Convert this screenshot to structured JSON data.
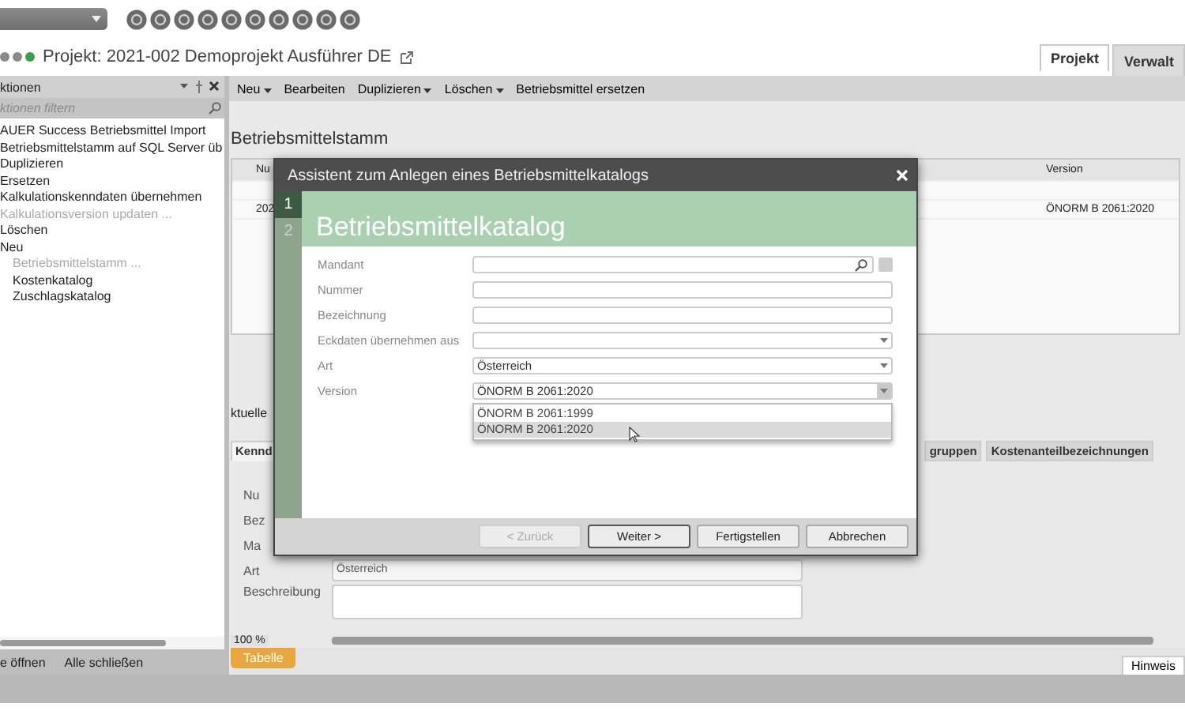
{
  "project": {
    "status_dots": [
      {
        "color": "#8a8a8a"
      },
      {
        "color": "#8a8a8a"
      },
      {
        "color": "#3aa04a"
      }
    ],
    "title": "Projekt: 2021-002 Demoprojekt Ausführer DE"
  },
  "ribbon_tabs": [
    {
      "label": "Projekt",
      "selected": false
    },
    {
      "label": "Verwalt",
      "selected": true
    }
  ],
  "side_panel": {
    "title": "ktionen",
    "filter_placeholder": "ktionen filtern",
    "items": [
      {
        "label": "AUER Success Betriebsmittel Import",
        "disabled": false
      },
      {
        "label": "Betriebsmittelstamm auf SQL Server üb",
        "disabled": false
      },
      {
        "label": "Duplizieren",
        "disabled": false
      },
      {
        "label": "Ersetzen",
        "disabled": false
      },
      {
        "label": "Kalkulationskenndaten übernehmen",
        "disabled": false
      },
      {
        "label": "Kalkulationsversion updaten ...",
        "disabled": true
      },
      {
        "label": "Löschen",
        "disabled": false
      },
      {
        "label": "Neu",
        "disabled": false,
        "children": [
          {
            "label": "Betriebsmittelstamm ...",
            "disabled": true
          },
          {
            "label": "Kostenkatalog",
            "disabled": false
          },
          {
            "label": "Zuschlagskatalog",
            "disabled": false
          }
        ]
      }
    ],
    "footer_links": [
      "e öffnen",
      "Alle schließen"
    ]
  },
  "toolbar": [
    {
      "label": "Neu",
      "menu": true
    },
    {
      "label": "Bearbeiten",
      "menu": false
    },
    {
      "label": "Duplizieren",
      "menu": true
    },
    {
      "label": "Löschen",
      "menu": true
    },
    {
      "label": "Betriebsmittel ersetzen",
      "menu": false
    }
  ],
  "heading": "Betriebsmittelstamm",
  "table": {
    "columns": [
      "Nu",
      "Version"
    ],
    "rows": [
      [
        "202",
        "ÖNORM B 2061:2020"
      ]
    ]
  },
  "details": {
    "label": "ktuelle",
    "tabs": [
      {
        "label": "Kennd",
        "selected": true
      },
      {
        "label": "gruppen",
        "selected": false
      },
      {
        "label": "Kostenanteilbezeichnungen",
        "selected": false
      }
    ],
    "fields": [
      {
        "label": "Nu",
        "kind": "hidden"
      },
      {
        "label": "Bez",
        "kind": "hidden"
      },
      {
        "label": "Ma",
        "kind": "hidden"
      },
      {
        "label": "Art",
        "kind": "text",
        "value": "Österreich"
      },
      {
        "label": "Beschreibung",
        "kind": "textarea"
      }
    ]
  },
  "zoom": "100 %",
  "bottom_tabs": [
    {
      "label": "Tabelle",
      "selected": true
    }
  ],
  "hint_tab": "Hinweis",
  "dialog": {
    "title": "Assistent zum Anlegen eines Betriebsmittelkatalogs",
    "steps": [
      {
        "label": "1",
        "selected": true
      },
      {
        "label": "2",
        "selected": false
      }
    ],
    "header": "Betriebsmittelkatalog",
    "fields": [
      {
        "label": "Mandant",
        "kind": "lookup"
      },
      {
        "label": "Nummer",
        "kind": "text"
      },
      {
        "label": "Bezeichnung",
        "kind": "text"
      },
      {
        "label": "Eckdaten übernehmen aus",
        "kind": "select"
      },
      {
        "label": "Art",
        "kind": "select",
        "value": "Österreich"
      },
      {
        "label": "Version",
        "kind": "select",
        "value": "ÖNORM B 2061:2020",
        "expanded": true,
        "options": [
          {
            "label": "ÖNORM B 2061:1999",
            "selected": false
          },
          {
            "label": "ÖNORM B 2061:2020",
            "selected": true
          }
        ]
      }
    ],
    "buttons": [
      {
        "label": "< Zurück",
        "disabled": true,
        "default": false
      },
      {
        "label": "Weiter >",
        "disabled": false,
        "default": true
      },
      {
        "label": "Fertigstellen",
        "disabled": false,
        "default": false
      },
      {
        "label": "Abbrechen",
        "disabled": false,
        "default": false
      }
    ]
  }
}
